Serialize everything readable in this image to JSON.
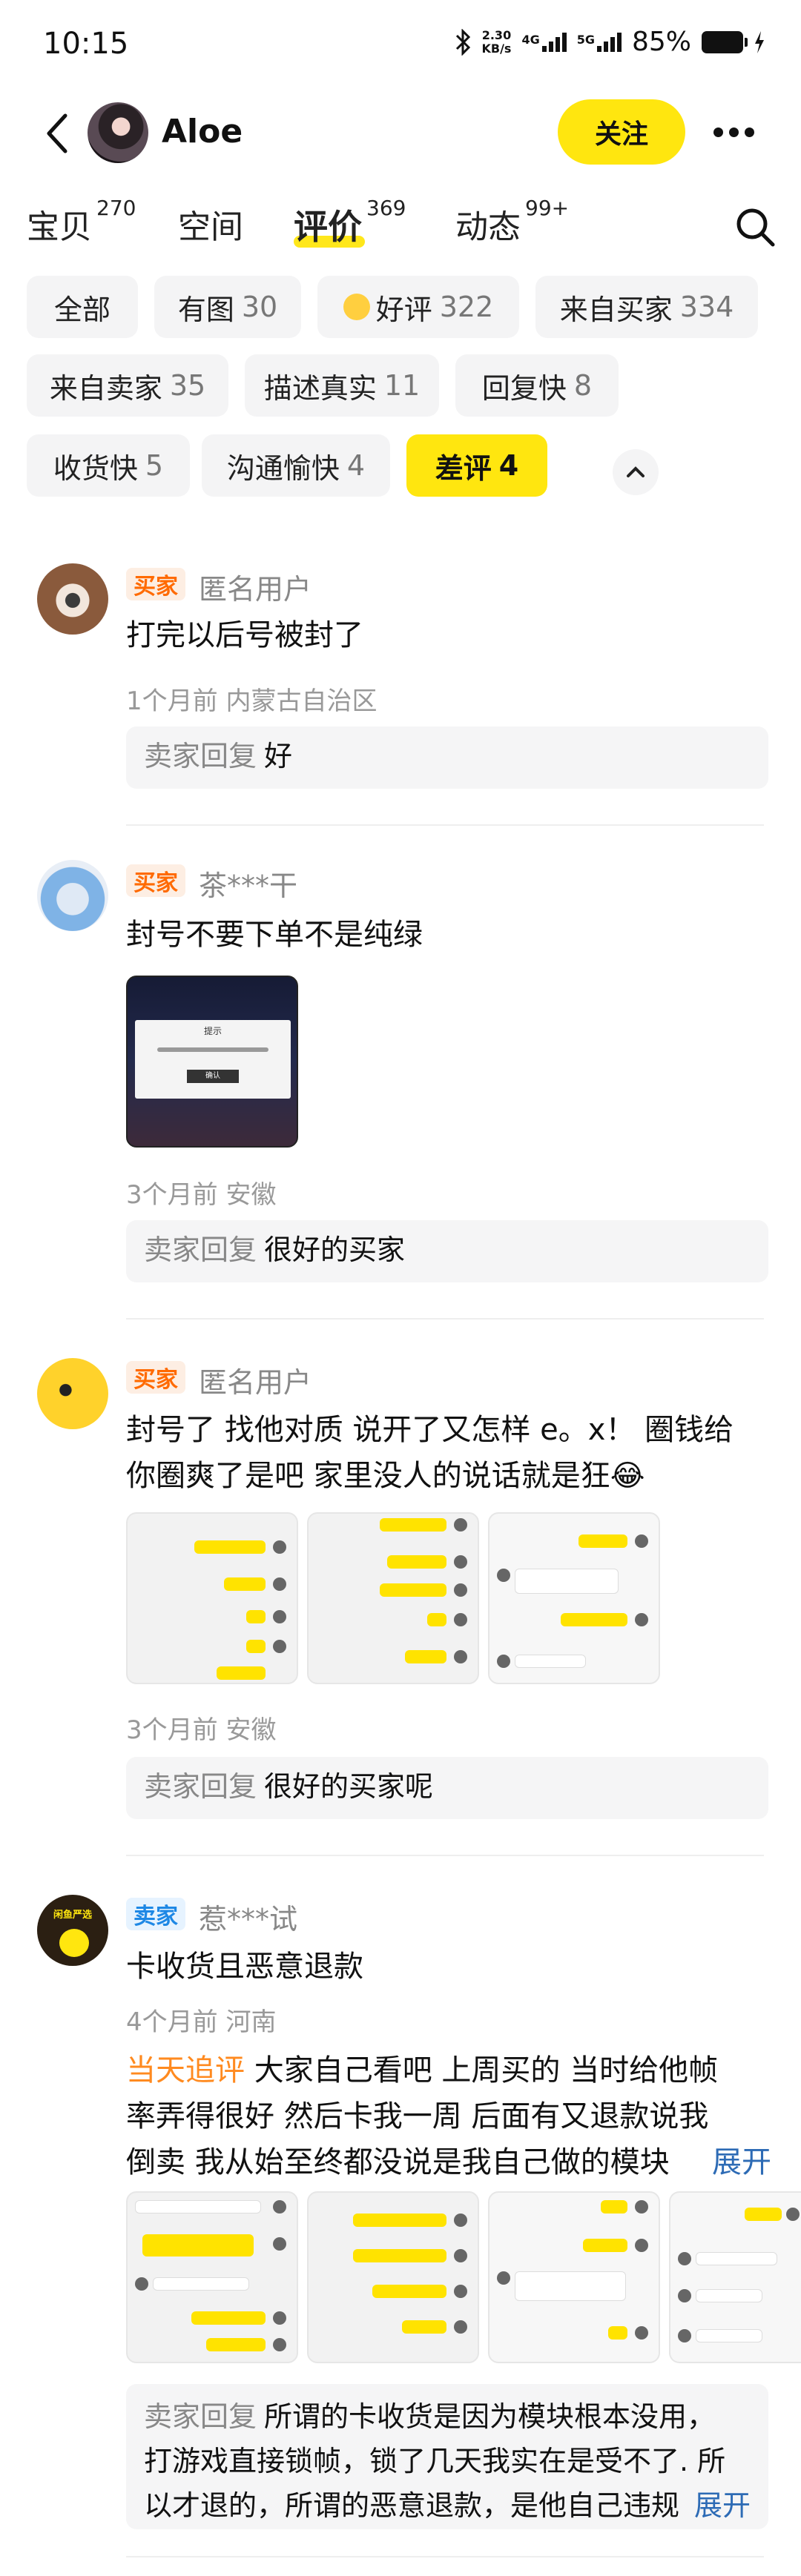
{
  "status": {
    "time": "10:15",
    "speed_value": "2.30",
    "speed_unit": "KB/s",
    "net1": "4G",
    "net2": "5G",
    "battery": "85%"
  },
  "header": {
    "user_name": "Aloe",
    "follow_label": "关注"
  },
  "tabs": [
    {
      "label": "宝贝",
      "count": "270"
    },
    {
      "label": "空间",
      "count": ""
    },
    {
      "label": "评价",
      "count": "369"
    },
    {
      "label": "动态",
      "count": "99+"
    }
  ],
  "filters": [
    {
      "label": "全部",
      "count": ""
    },
    {
      "label": "有图",
      "count": "30"
    },
    {
      "label": "好评",
      "count": "322"
    },
    {
      "label": "来自买家",
      "count": "334"
    },
    {
      "label": "来自卖家",
      "count": "35"
    },
    {
      "label": "描述真实",
      "count": "11"
    },
    {
      "label": "回复快",
      "count": "8"
    },
    {
      "label": "收货快",
      "count": "5"
    },
    {
      "label": "沟通愉快",
      "count": "4"
    },
    {
      "label": "差评",
      "count": "4"
    }
  ],
  "reviews": [
    {
      "role": "买家",
      "name": "匿名用户",
      "text": "打完以后号被封了",
      "meta": "1个月前 内蒙古自治区",
      "reply_label": "卖家回复",
      "reply": "好"
    },
    {
      "role": "买家",
      "name": "茶***干",
      "text": "封号不要下单不是纯绿",
      "meta": "3个月前 安徽",
      "reply_label": "卖家回复",
      "reply": "很好的买家",
      "img_title": "提示",
      "img_btn": "确认"
    },
    {
      "role": "买家",
      "name": "匿名用户",
      "text_line1": "封号了 找他对质 说开了又怎样 e。x！ 圈钱给",
      "text_line2": "你圈爽了是吧  家里没人的说话就是狂😂",
      "meta": "3个月前 安徽",
      "reply_label": "卖家回复",
      "reply": "很好的买家呢"
    },
    {
      "role": "卖家",
      "avatar_text": "闲鱼严选",
      "name": "惹***试",
      "text": "卡收货且恶意退款",
      "meta": "4个月前 河南",
      "followup_tag": "当天追评",
      "followup_line1": " 大家自己看吧 上周买的 当时给他帧",
      "followup_line2": "率弄得很好 然后卡我一周 后面有又退款说我",
      "followup_line3": "倒卖 我从始至终都没说是我自己做的模块",
      "expand": "展开",
      "reply_label": "卖家回复",
      "reply_line1": "所谓的卡收货是因为模块根本没用，",
      "reply_line2": "打游戏直接锁帧，锁了几天我实在是受不了. 所",
      "reply_line3": "以才退的，所谓的恶意退款，是他自己违规",
      "reply_expand": "展开"
    }
  ],
  "colors": {
    "accent": "#ffe60f",
    "buyer_badge": "#ff6a00",
    "seller_badge": "#1e88e5",
    "link": "#2d6bb5"
  }
}
